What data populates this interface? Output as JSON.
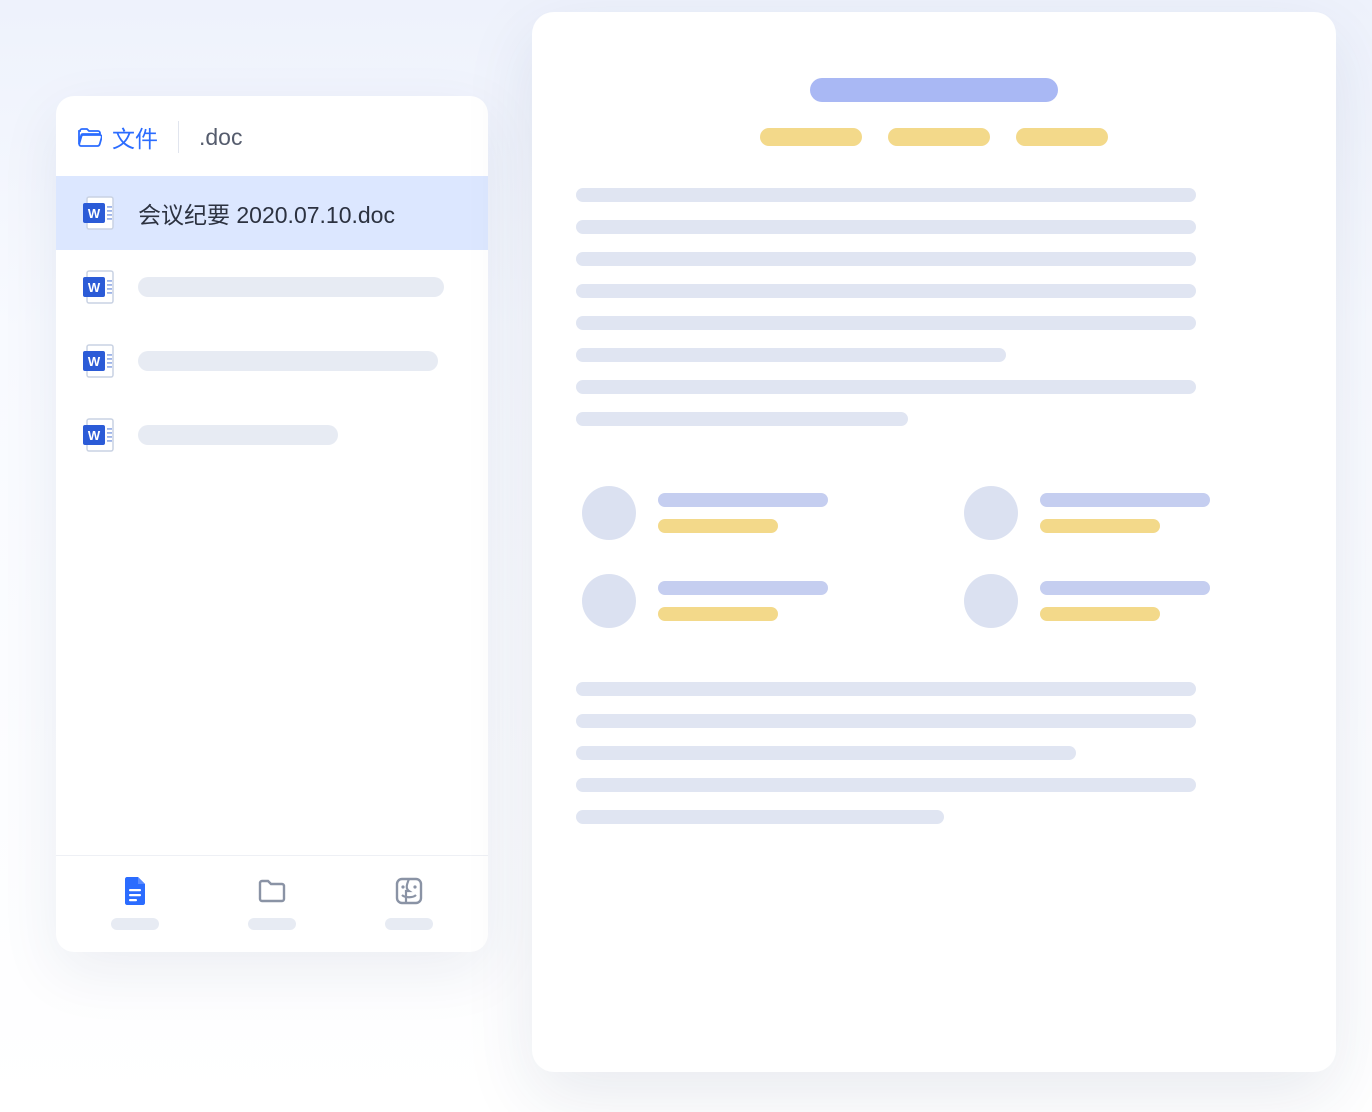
{
  "sidebar": {
    "tab_label": "文件",
    "search_query": ".doc",
    "files": [
      {
        "name": "会议纪要  2020.07.10.doc",
        "selected": true
      },
      {
        "name": "",
        "selected": false,
        "placeholder_width": 306
      },
      {
        "name": "",
        "selected": false,
        "placeholder_width": 300
      },
      {
        "name": "",
        "selected": false,
        "placeholder_width": 200
      }
    ],
    "nav": {
      "documents_active": true
    }
  },
  "preview": {
    "tags": [
      102,
      102,
      92
    ],
    "body_lines_1": [
      620,
      620,
      620,
      620,
      620,
      430,
      620,
      332
    ],
    "people": 4,
    "body_lines_2": [
      620,
      620,
      500,
      620,
      368
    ]
  },
  "colors": {
    "accent": "#2b6cff",
    "highlight_bg": "#dce7ff",
    "title_bar": "#a9b8f4",
    "tag": "#f3d98a",
    "skeleton": "#e0e5f2"
  }
}
